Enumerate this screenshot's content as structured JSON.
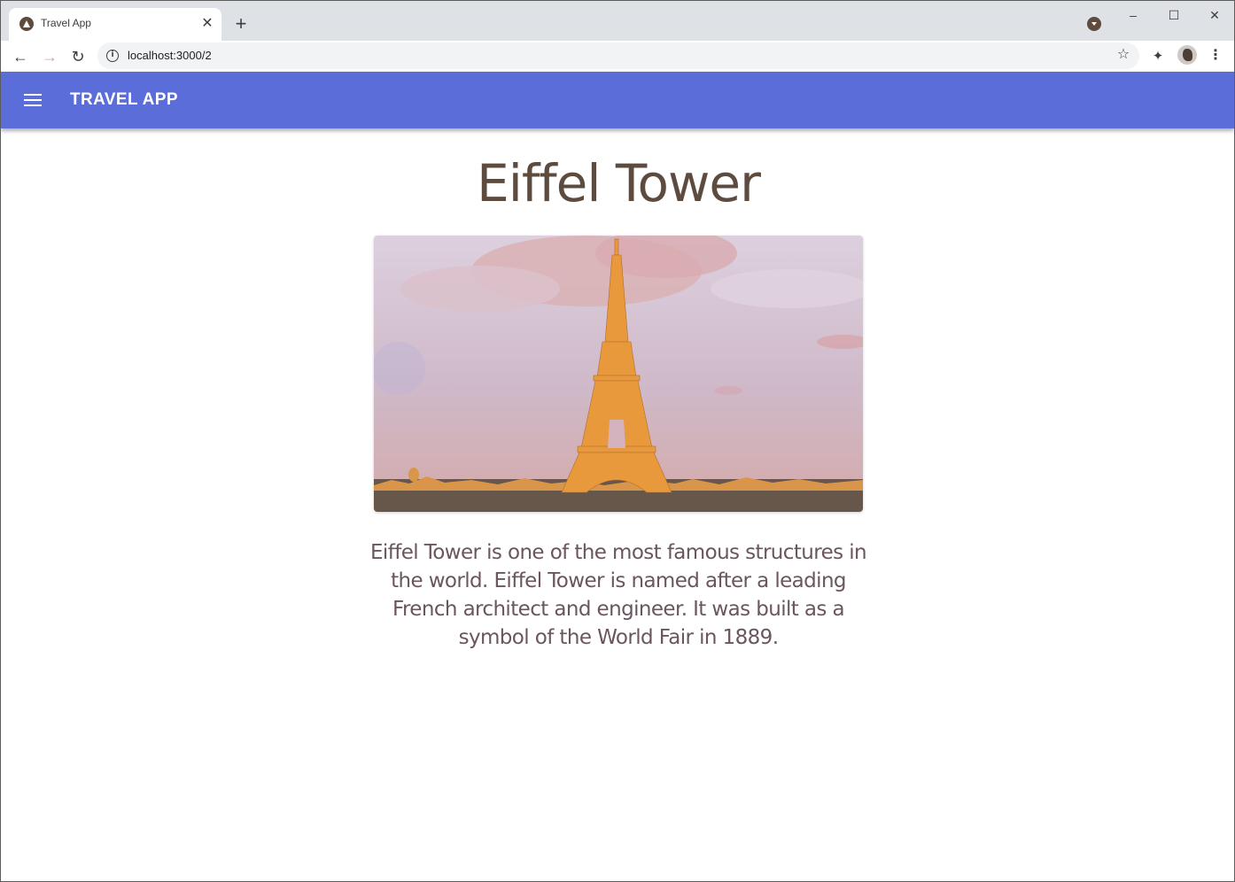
{
  "browser": {
    "tab": {
      "title": "Travel App",
      "favicon": "app-triangle-icon",
      "close_glyph": "✕"
    },
    "new_tab_glyph": "+",
    "window_controls": {
      "minimize": "–",
      "maximize": "☐",
      "close": "✕"
    },
    "toolbar": {
      "back_glyph": "←",
      "forward_glyph": "→",
      "reload_glyph": "↻",
      "url": "localhost:3000/2",
      "bookmark_glyph": "☆",
      "extensions_glyph": "✦",
      "menu_glyph": "⋮"
    }
  },
  "appbar": {
    "title": "TRAVEL APP",
    "background": "#5a6dd8",
    "menu_icon": "hamburger-icon"
  },
  "main": {
    "title": "Eiffel Tower",
    "image_alt": "Eiffel Tower photo",
    "description": "Eiffel Tower is one of the most famous structures in the world. Eiffel Tower is named after a leading French architect and engineer. It was built as a symbol of the World Fair in 1889."
  }
}
